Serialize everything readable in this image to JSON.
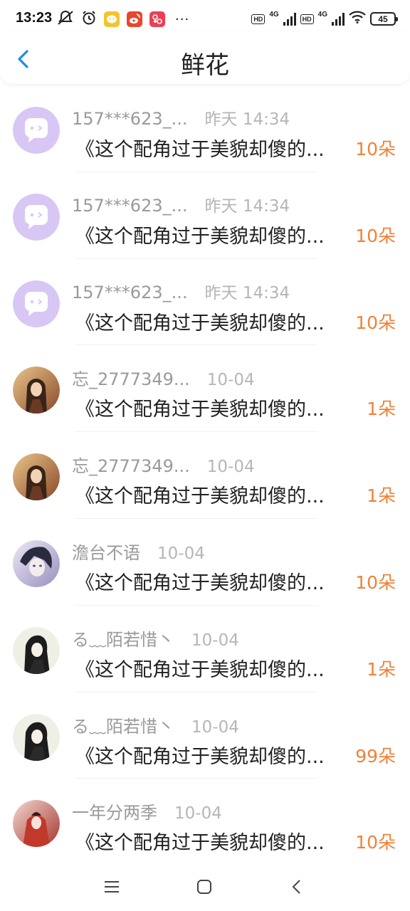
{
  "status_bar": {
    "time": "13:23",
    "left_icons": [
      "mute-icon",
      "alarm-icon",
      "wechat-icon",
      "weibo-icon",
      "red-app-icon"
    ],
    "overflow": "···",
    "hd1": "HD",
    "net1": "4G",
    "hd2": "HD",
    "net2": "4G",
    "battery": "45"
  },
  "header": {
    "title": "鲜花",
    "back_icon": "chevron-left-icon"
  },
  "items": [
    {
      "name": "157***623_...",
      "time": "昨天 14:34",
      "message": "《这个配角过于美貌却傻的...",
      "count": "10朵",
      "avatar": "default-chat"
    },
    {
      "name": "157***623_...",
      "time": "昨天 14:34",
      "message": "《这个配角过于美貌却傻的...",
      "count": "10朵",
      "avatar": "default-chat"
    },
    {
      "name": "157***623_...",
      "time": "昨天 14:34",
      "message": "《这个配角过于美貌却傻的...",
      "count": "10朵",
      "avatar": "default-chat"
    },
    {
      "name": "忘_2777349...",
      "time": "10-04",
      "message": "《这个配角过于美貌却傻的...",
      "count": "1朵",
      "avatar": "photo-warm"
    },
    {
      "name": "忘_2777349...",
      "time": "10-04",
      "message": "《这个配角过于美貌却傻的...",
      "count": "1朵",
      "avatar": "photo-warm"
    },
    {
      "name": "澹台不语",
      "time": "10-04",
      "message": "《这个配角过于美貌却傻的...",
      "count": "10朵",
      "avatar": "photo-purple"
    },
    {
      "name": "る﹏陌若惜丶",
      "time": "10-04",
      "message": "《这个配角过于美貌却傻的...",
      "count": "1朵",
      "avatar": "photo-dark"
    },
    {
      "name": "る﹏陌若惜丶",
      "time": "10-04",
      "message": "《这个配角过于美貌却傻的...",
      "count": "99朵",
      "avatar": "photo-dark"
    },
    {
      "name": "一年分两季",
      "time": "10-04",
      "message": "《这个配角过于美貌却傻的...",
      "count": "10朵",
      "avatar": "photo-red"
    }
  ],
  "colors": {
    "accent": "#1a8fe0",
    "count": "#ef8238",
    "default_avatar": "#d8c7f4"
  },
  "nav": {
    "icons": [
      "menu-icon",
      "home-icon",
      "back-icon"
    ]
  }
}
